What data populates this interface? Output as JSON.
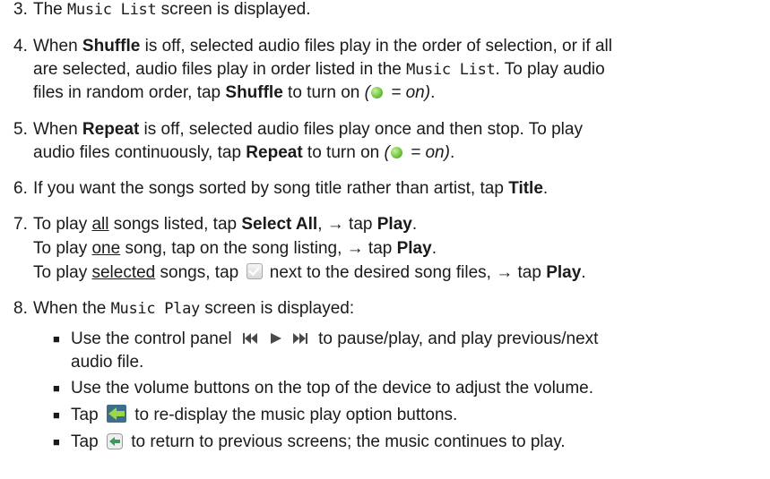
{
  "steps": [
    {
      "number": "3.",
      "parts": {
        "a": "The ",
        "mono": "Music List",
        "b": " screen is displayed."
      }
    },
    {
      "number": "4.",
      "l1": {
        "a": "When ",
        "b1": "Shuffle",
        "c": " is off, selected audio files play in the order of selection, or if all"
      },
      "l2": {
        "a": "are selected, audio files play in order listed in the ",
        "mono": "Music List",
        "c": ". To play audio"
      },
      "l3": {
        "a": "files in random order, tap ",
        "b1": "Shuffle",
        "c": " to turn on ",
        "paren_open": "(",
        "eq": " = on)",
        "end": "."
      }
    },
    {
      "number": "5.",
      "l1": {
        "a": "When ",
        "b1": "Repeat",
        "c": " is off, selected audio files play once and then stop. To play"
      },
      "l2": {
        "a": "audio files continuously, tap ",
        "b1": "Repeat",
        "c": " to turn on ",
        "paren_open": "(",
        "eq": " = on)",
        "end": "."
      }
    },
    {
      "number": "6.",
      "l1": {
        "a": "If you want the songs sorted by song title rather than artist, tap ",
        "b1": "Title",
        "end": "."
      }
    },
    {
      "number": "7.",
      "l1": {
        "a": "To play ",
        "u": "all",
        "c": " songs listed, tap ",
        "b1": "Select All",
        "d": ", → tap ",
        "b2": "Play",
        "end": "."
      },
      "l2": {
        "a": "To play ",
        "u": "one",
        "c": " song, tap on the song listing, → tap ",
        "b1": "Play",
        "end": "."
      },
      "l3": {
        "a": "To play ",
        "u": "selected",
        "c": " songs, tap ",
        "d": " next to the desired song files, → tap ",
        "b1": "Play",
        "end": "."
      }
    },
    {
      "number": "8.",
      "l1": {
        "a": "When the ",
        "mono": "Music Play",
        "c": " screen is displayed:"
      },
      "bullets": [
        {
          "a": "Use the control panel ",
          "c": " to pause/play, and play previous/next",
          "cont": "audio file."
        },
        {
          "a": "Use the volume buttons on the top of the device to adjust the volume."
        },
        {
          "a": "Tap ",
          "c": " to re-display the music play option buttons."
        },
        {
          "a": "Tap ",
          "c": " to return to previous screens; the music continues to play."
        }
      ]
    }
  ],
  "icons": {
    "on_indicator": "green-dot-icon",
    "checkbox": "checkbox-icon",
    "control_panel": "prev-play-next-icon",
    "back_arrow": "green-back-arrow-icon",
    "return": "return-arrow-icon"
  },
  "colors": {
    "text": "#1a1a1a",
    "on_dot": "#6cc23a",
    "arrow": "#2e8b57"
  }
}
